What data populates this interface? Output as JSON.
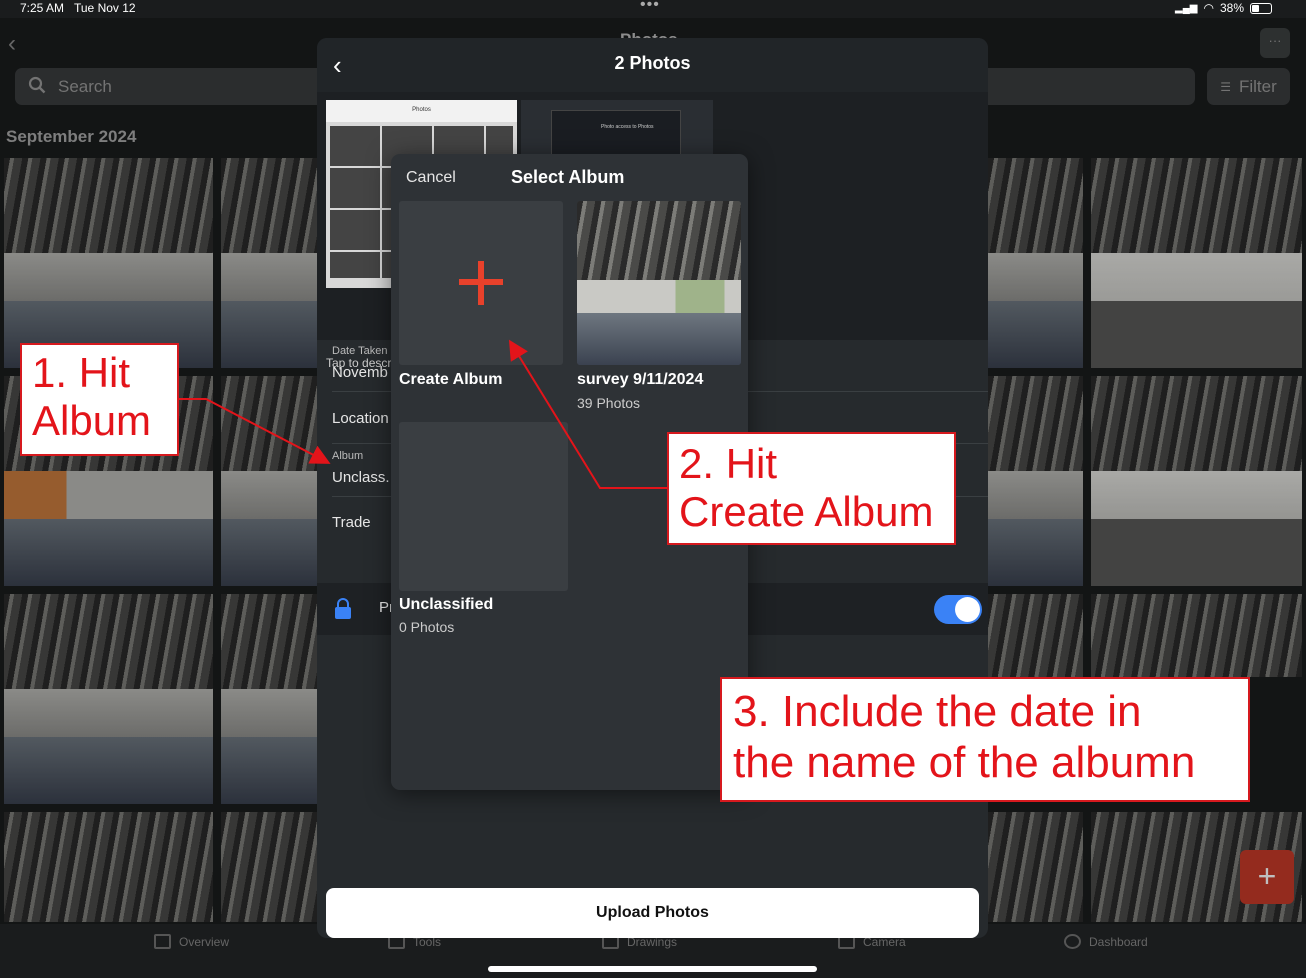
{
  "status_bar": {
    "time": "7:25 AM",
    "date": "Tue Nov 12",
    "battery": "38%"
  },
  "background": {
    "title": "Photos",
    "search_placeholder": "Search",
    "filter_label": "Filter",
    "section_heading": "September 2024",
    "more_icon": "ellipsis-icon"
  },
  "tab_bar": {
    "tabs": [
      {
        "label": "Overview",
        "icon": "grid-icon"
      },
      {
        "label": "Tools",
        "icon": "toolbox-icon"
      },
      {
        "label": "Drawings",
        "icon": "drawing-icon"
      },
      {
        "label": "Camera",
        "icon": "camera-icon"
      },
      {
        "label": "Dashboard",
        "icon": "gauge-icon"
      }
    ],
    "fab_label": "+"
  },
  "modal": {
    "title": "2 Photos",
    "tap_to_describe": "Tap to descri",
    "date_taken_label": "Date Taken",
    "date_taken_value": "Novemb",
    "location_label": "Location",
    "album_label": "Album",
    "album_value": "Unclass.",
    "trade_label": "Trade",
    "privacy_label": "Pr",
    "privacy_on": true,
    "upload_button": "Upload Photos",
    "thumb_title": "Photos",
    "thumb2_caption": "Photo access to Photos"
  },
  "album_picker": {
    "cancel_label": "Cancel",
    "title": "Select Album",
    "albums": [
      {
        "name": "Create Album",
        "count": ""
      },
      {
        "name": "survey 9/11/2024",
        "count": "39 Photos"
      },
      {
        "name": "Unclassified",
        "count": "0 Photos"
      }
    ]
  },
  "annotations": {
    "note1_line1": "1. Hit",
    "note1_line2": "Album",
    "note2_line1": "2. Hit",
    "note2_line2": "Create Album",
    "note3_line1": "3. Include the date in",
    "note3_line2": "the name of the albumn",
    "color": "#e3141a"
  },
  "colors": {
    "accent": "#e8412b",
    "toggle": "#3a82f6",
    "fab": "#c63a28"
  }
}
